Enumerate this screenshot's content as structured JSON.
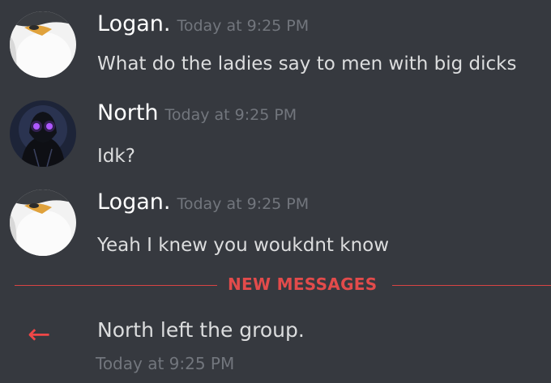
{
  "messages": [
    {
      "author": "Logan.",
      "timestamp": "Today at 9:25 PM",
      "text": "What do the ladies say to men with big dicks",
      "avatar": "penguin-avatar"
    },
    {
      "author": "North",
      "timestamp": "Today at 9:25 PM",
      "text": "Idk?",
      "avatar": "hooded-figure-avatar"
    },
    {
      "author": "Logan.",
      "timestamp": "Today at 9:25 PM",
      "text": "Yeah I knew you woukdnt know",
      "avatar": "penguin-avatar"
    }
  ],
  "divider": {
    "label": "NEW MESSAGES",
    "color": "#e24b4b"
  },
  "system_message": {
    "icon": "leave-arrow-icon",
    "text": "North left the group.",
    "timestamp": "Today at 9:25 PM"
  },
  "colors": {
    "background": "#36393f",
    "username": "#ffffff",
    "timestamp": "#72767d",
    "message_text": "#dcddde",
    "accent_red": "#f04747"
  }
}
